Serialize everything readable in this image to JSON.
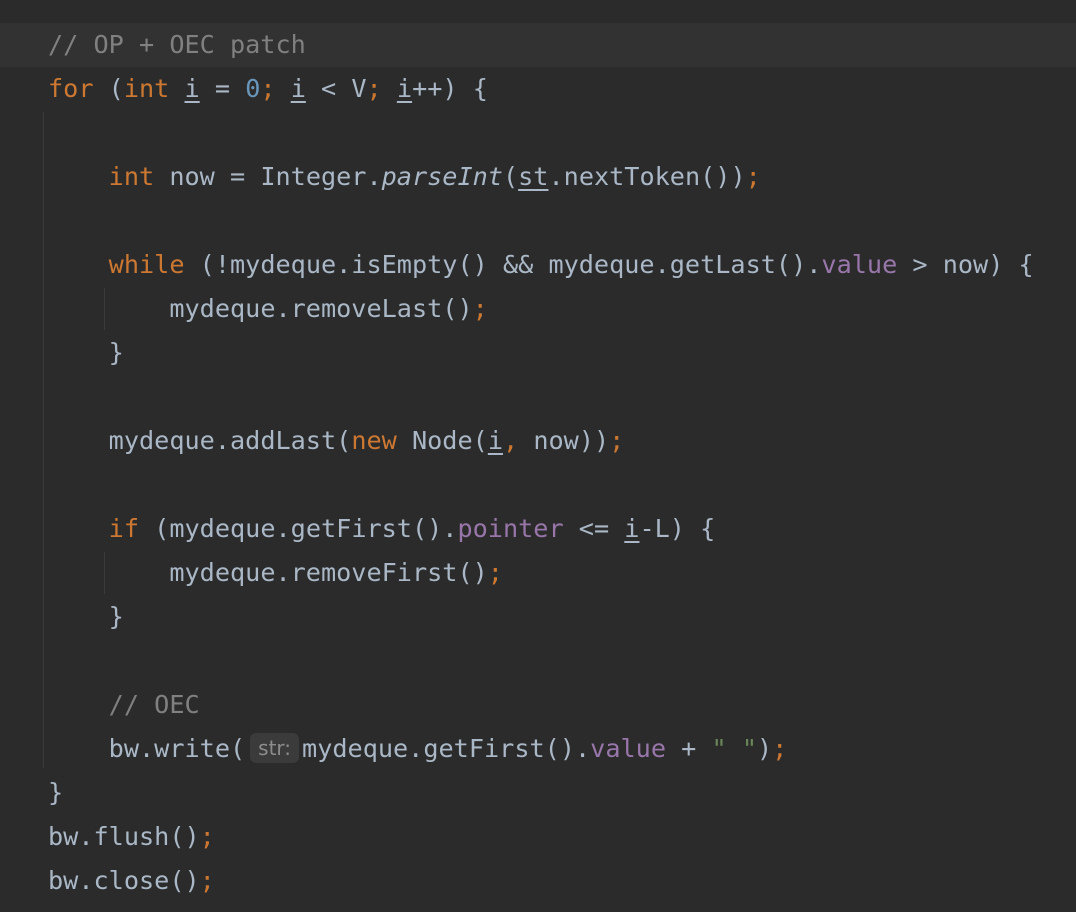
{
  "editor": {
    "colors": {
      "background": "#2b2b2b",
      "current_line": "#323232",
      "keyword": "#cc7832",
      "number": "#6897bb",
      "comment": "#808080",
      "field": "#9876aa",
      "string": "#6a8759",
      "default_text": "#a9b7c6"
    },
    "code": {
      "l1_comment": "// OP + OEC patch",
      "l2_for": "for",
      "l2_open": " (",
      "l2_int": "int",
      "l2_sp1": " ",
      "l2_i1": "i",
      "l2_eq": " = ",
      "l2_zero": "0",
      "l2_semi1": ";",
      "l2_sp2": " ",
      "l2_i2": "i",
      "l2_lt": " < V",
      "l2_semi2": ";",
      "l2_sp3": " ",
      "l2_i3": "i",
      "l2_close": "++) {",
      "l4_indent": "    ",
      "l4_int": "int",
      "l4_a": " now = Integer.",
      "l4_parse": "parseInt",
      "l4_b": "(",
      "l4_st": "st",
      "l4_c": ".nextToken())",
      "l4_semi": ";",
      "l6_indent": "    ",
      "l6_while": "while",
      "l6_a": " (!mydeque.isEmpty() && mydeque.getLast().",
      "l6_value": "value",
      "l6_b": " > now) {",
      "l7_indent": "        ",
      "l7_a": "mydeque.removeLast()",
      "l7_semi": ";",
      "l8": "    }",
      "l10_indent": "    ",
      "l10_a": "mydeque.addLast(",
      "l10_new": "new",
      "l10_b": " Node(",
      "l10_i": "i",
      "l10_comma": ",",
      "l10_c": " now))",
      "l10_semi": ";",
      "l12_indent": "    ",
      "l12_if": "if",
      "l12_a": " (mydeque.getFirst().",
      "l12_pointer": "pointer",
      "l12_b": " <= ",
      "l12_i": "i",
      "l12_c": "-L) {",
      "l13_indent": "        ",
      "l13_a": "mydeque.removeFirst()",
      "l13_semi": ";",
      "l14": "    }",
      "l16_indent": "    ",
      "l16_comment": "// OEC",
      "l17_indent": "    ",
      "l17_a": "bw.write(",
      "l17_hint": "str:",
      "l17_b": "mydeque.getFirst().",
      "l17_value": "value",
      "l17_c": " + ",
      "l17_str": "\" \"",
      "l17_d": ")",
      "l17_semi": ";",
      "l18": "}",
      "l19_a": "bw.flush()",
      "l19_semi": ";",
      "l20_a": "bw.close()",
      "l20_semi": ";"
    }
  }
}
